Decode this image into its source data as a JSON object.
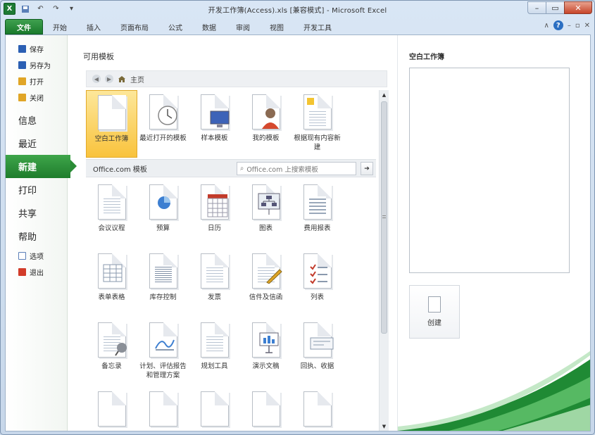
{
  "window": {
    "title": "开发工作簿(Access).xls [兼容模式] - Microsoft Excel",
    "qat": [
      "excel-logo",
      "save-icon",
      "undo-icon",
      "redo-icon",
      "customize-icon"
    ],
    "controls": [
      "–",
      "▭",
      "✕"
    ]
  },
  "ribbon": {
    "file_tab": "文件",
    "tabs": [
      "开始",
      "插入",
      "页面布局",
      "公式",
      "数据",
      "审阅",
      "视图",
      "开发工具"
    ]
  },
  "leftnav": {
    "small_top": [
      {
        "label": "保存",
        "color": "#2b5fb3"
      },
      {
        "label": "另存为",
        "color": "#2b5fb3"
      },
      {
        "label": "打开",
        "color": "#e0a526"
      },
      {
        "label": "关闭",
        "color": "#e0a526"
      }
    ],
    "big": [
      "信息",
      "最近",
      "新建",
      "打印",
      "共享",
      "帮助"
    ],
    "active": "新建",
    "small_bottom": [
      {
        "label": "选项",
        "color": "#5a7fb8"
      },
      {
        "label": "退出",
        "color": "#d23c2a"
      }
    ]
  },
  "middle": {
    "section_title": "可用模板",
    "breadcrumb": "主页",
    "local_templates": [
      {
        "label": "空白工作簿",
        "icon": "blank-doc"
      },
      {
        "label": "最近打开的模板",
        "icon": "clock"
      },
      {
        "label": "样本模板",
        "icon": "monitor"
      },
      {
        "label": "我的模板",
        "icon": "person"
      },
      {
        "label": "根据现有内容新建",
        "icon": "folder-doc"
      }
    ],
    "office_bar": {
      "label": "Office.com 模板",
      "search_placeholder": "Office.com 上搜索模板",
      "go": "➔"
    },
    "office_templates": [
      {
        "label": "会议议程",
        "icon": "agenda"
      },
      {
        "label": "预算",
        "icon": "pie"
      },
      {
        "label": "日历",
        "icon": "calendar"
      },
      {
        "label": "图表",
        "icon": "org-chart"
      },
      {
        "label": "费用报表",
        "icon": "expense"
      },
      {
        "label": "表单表格",
        "icon": "form"
      },
      {
        "label": "库存控制",
        "icon": "inventory"
      },
      {
        "label": "发票",
        "icon": "invoice"
      },
      {
        "label": "信件及信函",
        "icon": "letter-pen"
      },
      {
        "label": "列表",
        "icon": "checklist"
      },
      {
        "label": "备忘录",
        "icon": "memo-pin"
      },
      {
        "label": "计划、评估报告和管理方案",
        "icon": "plan"
      },
      {
        "label": "规划工具",
        "icon": "planner"
      },
      {
        "label": "演示文稿",
        "icon": "presentation"
      },
      {
        "label": "回执、收据",
        "icon": "receipt"
      }
    ]
  },
  "right": {
    "title": "空白工作簿",
    "create_label": "创建"
  },
  "colors": {
    "accent_green": "#1f7d2c",
    "selected_yellow": "#f9c33d"
  }
}
